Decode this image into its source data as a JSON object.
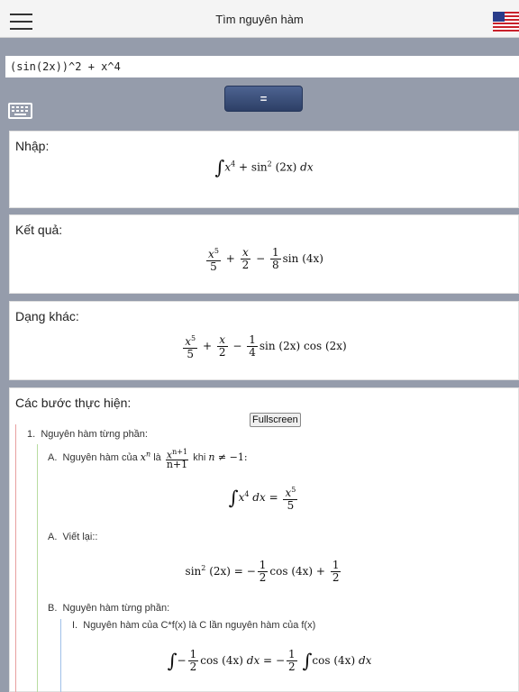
{
  "header": {
    "title": "Tìm nguyên hàm",
    "menu_icon": "hamburger-menu-icon",
    "flag_icon": "us-flag-icon"
  },
  "input": {
    "value": "(sin(2x))^2 + x^4"
  },
  "equals_button": {
    "label": "="
  },
  "keyboard_icon": "keyboard-icon",
  "sections": {
    "input": {
      "title": "Nhập:"
    },
    "result": {
      "title": "Kết quả:"
    },
    "alternate": {
      "title": "Dạng khác:"
    },
    "steps": {
      "title": "Các bước thực hiện:",
      "fullscreen_label": "Fullscreen"
    }
  },
  "math": {
    "x": "x",
    "dx": "dx",
    "n": "n",
    "sin": "sin",
    "cos": "cos",
    "arg2x": "(2x)",
    "arg4x": "(4x)",
    "p2": "2",
    "p4": "4",
    "p5": "5",
    "pn": "n",
    "one": "1",
    "two": "2",
    "four": "4",
    "five": "5",
    "eight": "8",
    "n_plus_1": "n+1",
    "n_plus_1_exp": "n+1",
    "plus": "+",
    "minus": "−",
    "equals": "=",
    "neq_minus_one": "≠ −1:",
    "integral": "∫"
  },
  "steps": [
    {
      "marker": "1.",
      "text": "Nguyên hàm từng phần:",
      "substeps": [
        {
          "marker": "A.",
          "prefix": "Nguyên hàm của",
          "middle": "là",
          "suffix": "khi"
        },
        {
          "marker": "A.",
          "text": "Viết lại::"
        },
        {
          "marker": "B.",
          "text": "Nguyên hàm từng phần:",
          "substeps": [
            {
              "marker": "I.",
              "text": "Nguyên hàm của C*f(x) là C lần nguyên hàm của f(x)"
            }
          ]
        }
      ]
    }
  ],
  "colors": {
    "background": "#959cab",
    "header": "#f4f4f4",
    "button": "#2d3f66",
    "step_line_1": "#e8a0a0",
    "step_line_2": "#b8dca0",
    "step_line_3": "#a0c0e8"
  }
}
